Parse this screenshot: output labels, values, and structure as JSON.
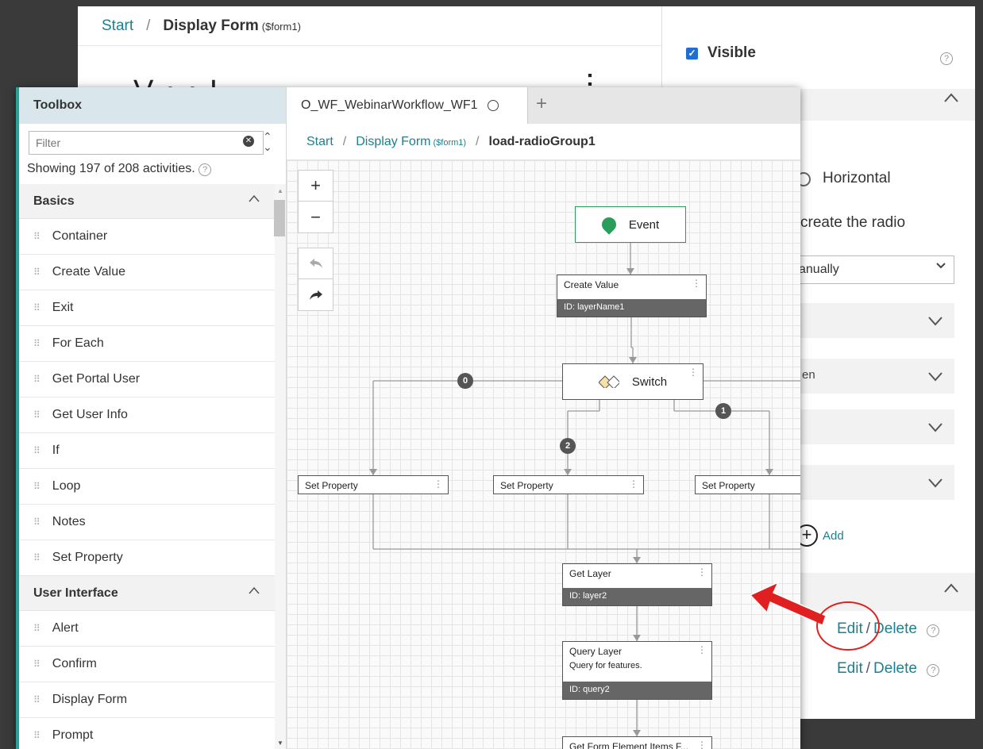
{
  "back_window": {
    "breadcrumb": {
      "start": "Start",
      "sep": "/",
      "current": "Display Form",
      "current_suffix": "($form1)"
    },
    "heading": "V     •   •             I",
    "colon": ":",
    "visible_label": "Visible",
    "help_glyph": "?"
  },
  "right_panel": {
    "layout_option": "Horizontal",
    "create_text": "create the radio",
    "select_value": "anually",
    "partial_row_label": "en",
    "add_label": "Add",
    "actions": [
      {
        "edit": "Edit",
        "sep": "/",
        "delete": "Delete"
      },
      {
        "edit": "Edit",
        "sep": "/",
        "delete": "Delete"
      }
    ]
  },
  "toolbox": {
    "title": "Toolbox",
    "filter_placeholder": "Filter",
    "showing": "Showing 197 of 208 activities.",
    "categories": [
      {
        "name": "Basics",
        "items": [
          "Container",
          "Create Value",
          "Exit",
          "For Each",
          "Get Portal User",
          "Get User Info",
          "If",
          "Loop",
          "Notes",
          "Set Property"
        ]
      },
      {
        "name": "User Interface",
        "items": [
          "Alert",
          "Confirm",
          "Display Form",
          "Prompt"
        ]
      }
    ]
  },
  "designer": {
    "tab_title": "O_WF_WebinarWorkflow_WF1",
    "breadcrumb": {
      "start": "Start",
      "sep": "/",
      "mid": "Display Form",
      "mid_suffix": "($form1)",
      "current": "load-radioGroup1"
    },
    "nodes": {
      "event": "Event",
      "create_value": {
        "title": "Create Value",
        "id": "ID: layerName1"
      },
      "switch": "Switch",
      "set_property_1": "Set Property",
      "set_property_2": "Set Property",
      "set_property_3": "Set Property",
      "get_layer": {
        "title": "Get Layer",
        "id": "ID: layer2"
      },
      "query_layer": {
        "title": "Query Layer",
        "desc": "Query for features.",
        "id": "ID: query2"
      },
      "get_form": "Get Form Element Items F..."
    },
    "badges": [
      "0",
      "2",
      "1"
    ]
  },
  "colors": {
    "accent": "#1f7f8c",
    "event_green": "#2a9d5c",
    "annotation_red": "#e02020"
  }
}
